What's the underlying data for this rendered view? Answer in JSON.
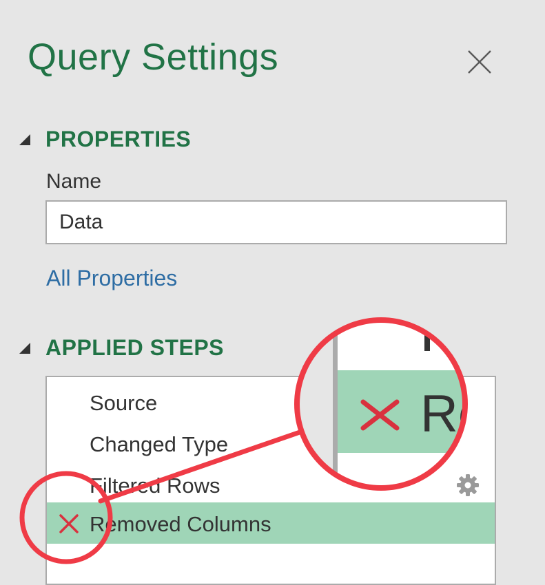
{
  "pane": {
    "title": "Query Settings",
    "close_icon": "close-icon"
  },
  "properties": {
    "header": "PROPERTIES",
    "name_label": "Name",
    "name_value": "Data",
    "all_properties_link": "All Properties"
  },
  "applied_steps": {
    "header": "APPLIED STEPS",
    "steps": [
      {
        "label": "Source",
        "selected": false,
        "error": false
      },
      {
        "label": "Changed Type",
        "selected": false,
        "error": false
      },
      {
        "label": "Filtered Rows",
        "selected": false,
        "error": false,
        "settings_icon": "gear-icon"
      },
      {
        "label": "Removed Columns",
        "selected": true,
        "error": true,
        "status_icon": "error-x-icon"
      }
    ]
  },
  "zoom_callout": {
    "text": "Re"
  },
  "colors": {
    "accent": "#217346",
    "link": "#2e6da4",
    "selected_row": "#9fd5b7",
    "error": "#d9313e",
    "annotation": "#ef3b46",
    "pane_background": "#e6e6e6"
  }
}
